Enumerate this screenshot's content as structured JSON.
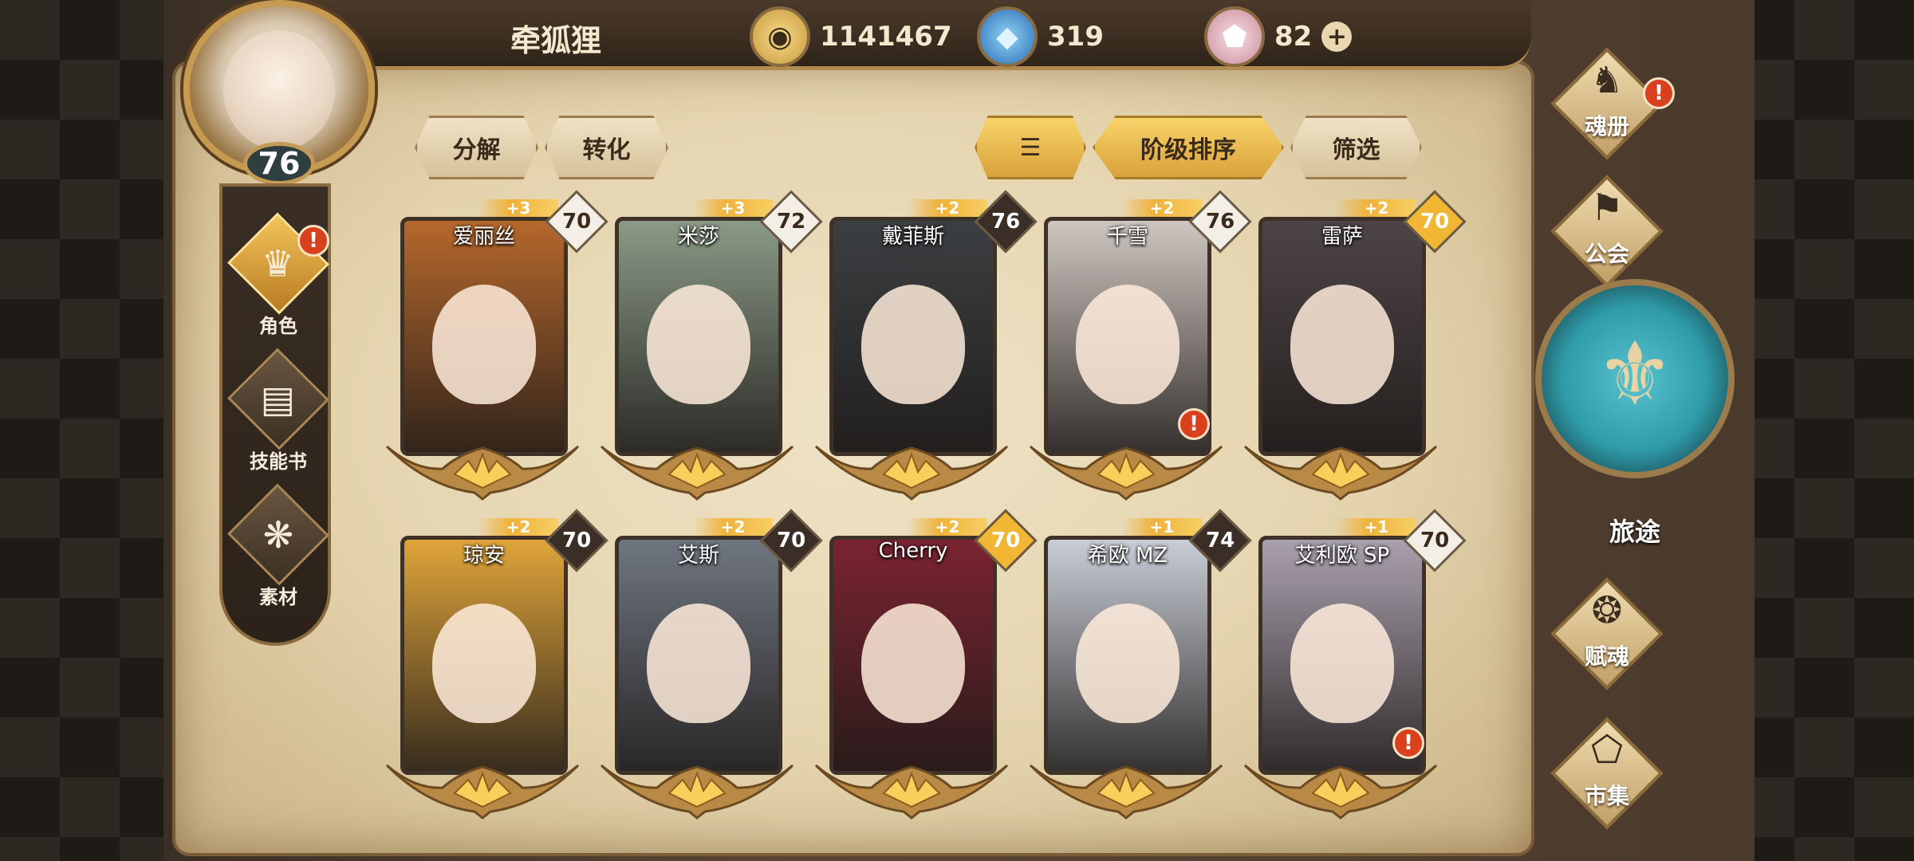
{
  "player": {
    "name": "牵狐狸",
    "level": "76"
  },
  "currencies": [
    {
      "icon": "gold-coin-icon",
      "value": "1141467"
    },
    {
      "icon": "blue-crystal-icon",
      "value": "319"
    },
    {
      "icon": "pink-gem-icon",
      "value": "82"
    }
  ],
  "left_nav": [
    {
      "label": "角色",
      "icon": "character-helm-icon",
      "active": true,
      "alert": true
    },
    {
      "label": "技能书",
      "icon": "skill-book-icon",
      "active": false,
      "alert": false
    },
    {
      "label": "素材",
      "icon": "material-icon",
      "active": false,
      "alert": false
    }
  ],
  "toolbar": {
    "decompose": "分解",
    "convert": "转化",
    "sort_rank": "阶级排序",
    "filter": "筛选"
  },
  "heroes": [
    {
      "name": "爱丽丝",
      "rank": "70",
      "plus": "+3",
      "rank_style": "white",
      "art": "#b5682c",
      "alert": false
    },
    {
      "name": "米莎",
      "rank": "72",
      "plus": "+3",
      "rank_style": "white",
      "art": "#8a9a86",
      "alert": false
    },
    {
      "name": "戴菲斯",
      "rank": "76",
      "plus": "+2",
      "rank_style": "dark",
      "art": "#3c3f42",
      "alert": false
    },
    {
      "name": "千雪",
      "rank": "76",
      "plus": "+2",
      "rank_style": "white",
      "art": "#cfc6c0",
      "alert": true
    },
    {
      "name": "雷萨",
      "rank": "70",
      "plus": "+2",
      "rank_style": "gold",
      "art": "#4d4446",
      "alert": false
    },
    {
      "name": "琼安",
      "rank": "70",
      "plus": "+2",
      "rank_style": "dark",
      "art": "#e0a43a",
      "alert": false
    },
    {
      "name": "艾斯",
      "rank": "70",
      "plus": "+2",
      "rank_style": "dark",
      "art": "#6f7680",
      "alert": false
    },
    {
      "name": "Cherry",
      "rank": "70",
      "plus": "+2",
      "rank_style": "gold",
      "art": "#7a2430",
      "alert": false
    },
    {
      "name": "希欧 MZ",
      "rank": "74",
      "plus": "+1",
      "rank_style": "dark",
      "art": "#c9cdd6",
      "alert": false
    },
    {
      "name": "艾利欧 SP",
      "rank": "70",
      "plus": "+1",
      "rank_style": "white",
      "art": "#a9a0ad",
      "alert": true
    }
  ],
  "right_menu": {
    "soul_book": "魂册",
    "guild": "公会",
    "journey": "旅途",
    "soul_grant": "赋魂",
    "market": "市集"
  },
  "colors": {
    "accent_gold": "#f0b23a",
    "alert_red": "#d9411e",
    "journey_teal": "#2f9aa8"
  }
}
